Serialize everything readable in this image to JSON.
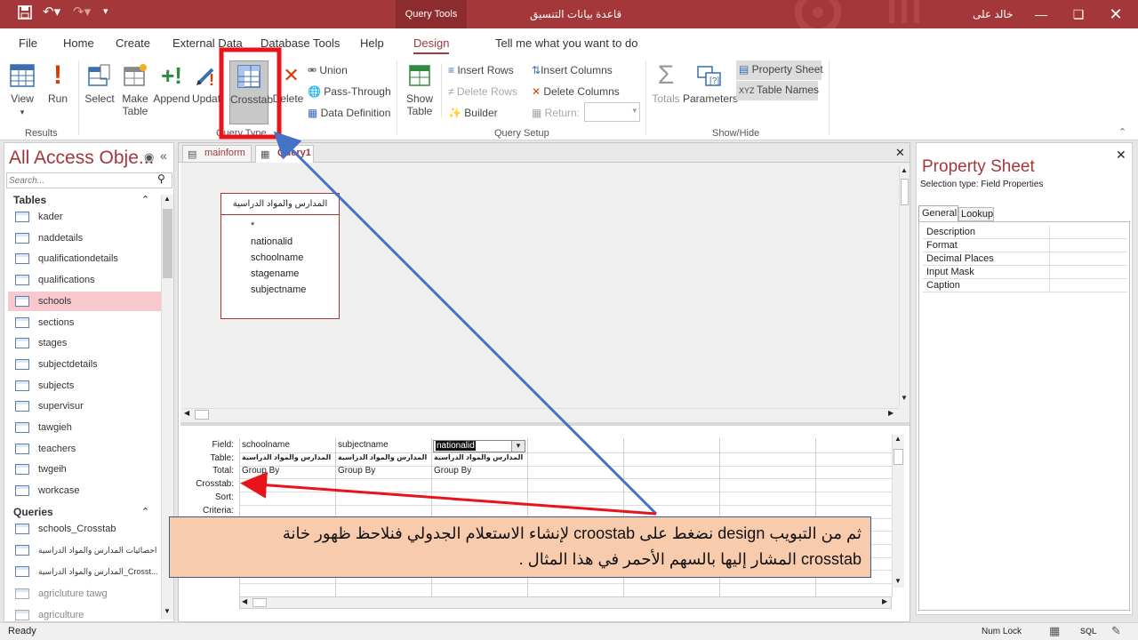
{
  "window": {
    "context_tab": "Query Tools",
    "doc_title": "قاعدة بيانات التنسيق",
    "user": "خالد على"
  },
  "menu": {
    "tabs": [
      "File",
      "Home",
      "Create",
      "External Data",
      "Database Tools",
      "Help",
      "Design"
    ],
    "tell_me": "Tell me what you want to do"
  },
  "ribbon": {
    "results": {
      "view": "View",
      "run": "Run",
      "group": "Results"
    },
    "query_type": {
      "select": "Select",
      "make_table_1": "Make",
      "make_table_2": "Table",
      "append": "Append",
      "update": "Updat",
      "crosstab": "Crosstab",
      "delete": "Delete",
      "union": "Union",
      "pass_through": "Pass-Through",
      "data_definition": "Data Definition",
      "group": "Query Type"
    },
    "query_setup": {
      "show_table_1": "Show",
      "show_table_2": "Table",
      "insert_rows": "Insert Rows",
      "delete_rows": "Delete Rows",
      "builder": "Builder",
      "insert_columns": "Insert Columns",
      "delete_columns": "Delete Columns",
      "return": "Return:",
      "group": "Query Setup"
    },
    "show_hide": {
      "totals": "Totals",
      "parameters": "Parameters",
      "property_sheet": "Property Sheet",
      "table_names": "Table Names",
      "group": "Show/Hide"
    }
  },
  "nav": {
    "title": "All Access Obje...",
    "search_placeholder": "Search...",
    "tables_header": "Tables",
    "tables": [
      "kader",
      "naddetails",
      "qualificationdetails",
      "qualifications",
      "schools",
      "sections",
      "stages",
      "subjectdetails",
      "subjects",
      "supervisur",
      "tawgieh",
      "teachers",
      "twgeih",
      "workcase"
    ],
    "queries_header": "Queries",
    "queries": [
      "schools_Crosstab",
      "احصائيات المدارس والمواد الدراسية",
      "المدارس والمواد الدراسية_Crosst...",
      "agricluture tawg",
      "agriculture"
    ]
  },
  "doc_tabs": {
    "mainform": "mainform",
    "query1": "Query1"
  },
  "table_box": {
    "title": "المدارس والمواد الدراسية",
    "fields": [
      "*",
      "nationalid",
      "schoolname",
      "stagename",
      "subjectname"
    ]
  },
  "grid": {
    "row_labels": [
      "Field:",
      "Table:",
      "Total:",
      "Crosstab:",
      "Sort:",
      "Criteria:"
    ],
    "columns": [
      {
        "field": "schoolname",
        "table": "المدارس والمواد الدراسية",
        "total": "Group By"
      },
      {
        "field": "subjectname",
        "table": "المدارس والمواد الدراسية",
        "total": "Group By"
      },
      {
        "field": "nationalid",
        "table": "المدارس والمواد الدراسية",
        "total": "Group By"
      }
    ]
  },
  "property_sheet": {
    "title": "Property Sheet",
    "selection_type": "Selection type:  Field Properties",
    "tabs": [
      "General",
      "Lookup"
    ],
    "rows": [
      "Description",
      "Format",
      "Decimal Places",
      "Input Mask",
      "Caption"
    ]
  },
  "callout": {
    "line1": "ثم من التبويب design نضغط على croostab لإنشاء الاستعلام الجدولي فنلاحظ ظهور خانة",
    "line2": "crosstab المشار إليها بالسهم  الأحمر في هذا المثال ."
  },
  "status": {
    "ready": "Ready",
    "num_lock": "Num Lock",
    "sql": "SQL"
  },
  "colors": {
    "accent": "#a4373a",
    "highlight_box": "#e8141c",
    "callout_bg": "#f8cbad",
    "arrow_blue": "#4472c4",
    "arrow_red": "#e8141c"
  }
}
